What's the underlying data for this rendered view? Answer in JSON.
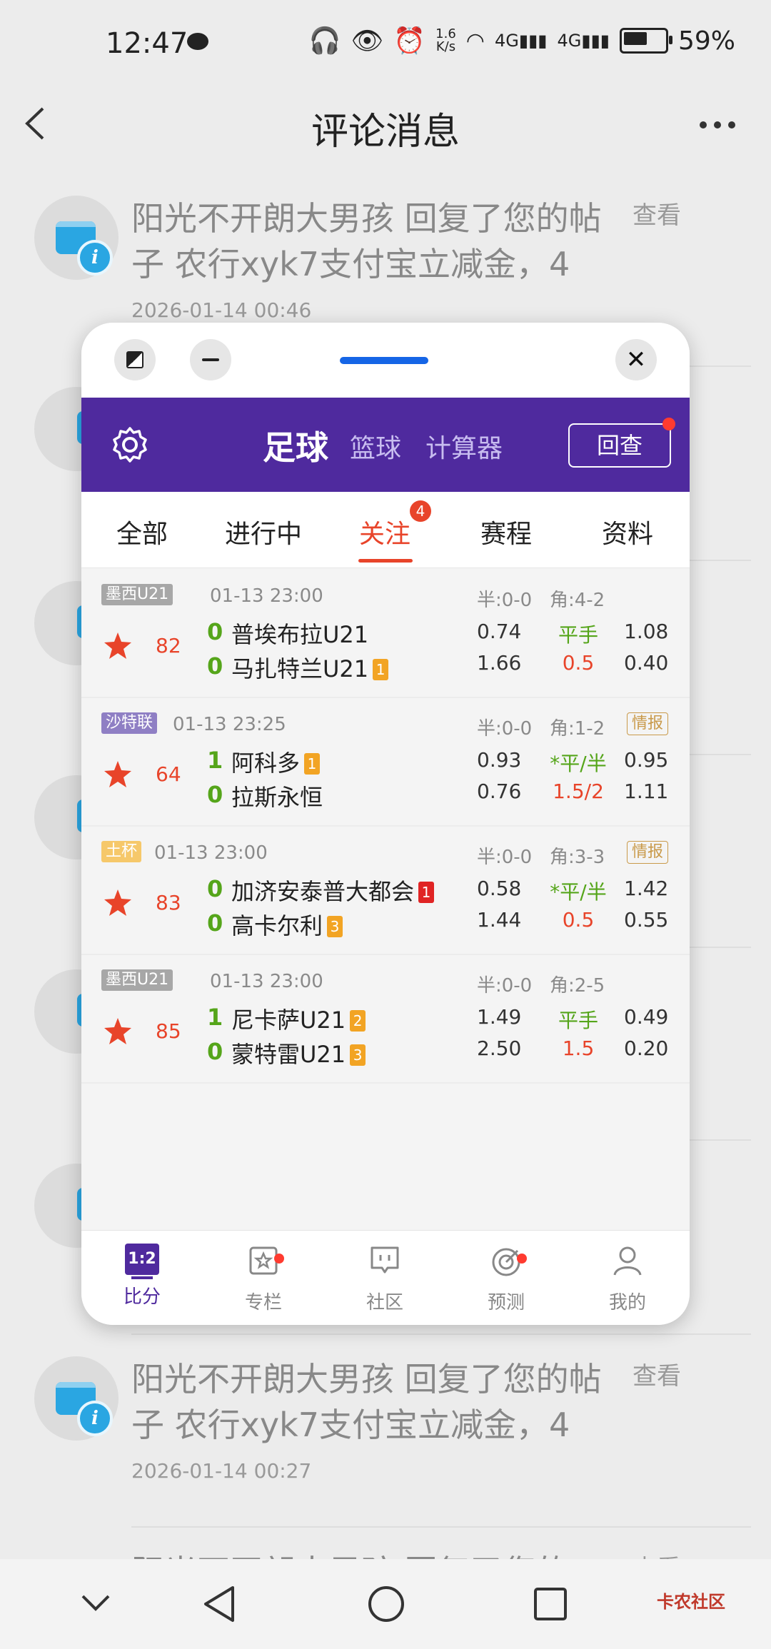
{
  "status_bar": {
    "time": "12:47",
    "net_speed": "1.6\nK/s",
    "signal1": "4G",
    "signal2": "4G",
    "battery": "59%"
  },
  "header": {
    "title": "评论消息"
  },
  "messages": [
    {
      "text": "阳光不开朗大男孩 回复了您的帖子 农行xyk7支付宝立减金，4",
      "time": "2026-01-14 00:46",
      "view": "查看"
    },
    {
      "text": "阳光不开朗大男孩 回复了您的帖子 农行xyk7支付宝立减金，4",
      "time": "2026-01-14 00:27",
      "view": "查看"
    },
    {
      "text": "阳光不开朗大男孩 回复了您的",
      "view": "查看"
    }
  ],
  "panel": {
    "nav": {
      "sports": [
        "足球",
        "篮球",
        "计算器"
      ],
      "recheck": "回查"
    },
    "tabs": [
      "全部",
      "进行中",
      "关注",
      "赛程",
      "资料"
    ],
    "follow_badge": "4",
    "matches": [
      {
        "league": "墨西U21",
        "league_color": "#a7a7a7",
        "time": "01-13 23:00",
        "half": "半:0-0",
        "corner": "角:4-2",
        "intel": "",
        "minute": "82",
        "home": {
          "score": "0",
          "name": "普埃布拉U21",
          "card": "",
          "card_type": ""
        },
        "away": {
          "score": "0",
          "name": "马扎特兰U21",
          "card": "1",
          "card_type": "y"
        },
        "odds": {
          "home": "0.74",
          "hcp": "平手",
          "hcp_color": "#55a51a",
          "away": "1.08",
          "home2": "1.66",
          "hcp2": "0.5",
          "away2": "0.40"
        }
      },
      {
        "league": "沙特联",
        "league_color": "#8f7fc4",
        "time": "01-13 23:25",
        "half": "半:0-0",
        "corner": "角:1-2",
        "intel": "情报",
        "minute": "64",
        "home": {
          "score": "1",
          "name": "阿科多",
          "card": "1",
          "card_type": "y"
        },
        "away": {
          "score": "0",
          "name": "拉斯永恒",
          "card": "",
          "card_type": ""
        },
        "odds": {
          "home": "0.93",
          "hcp": "*平/半",
          "hcp_color": "#55a51a",
          "away": "0.95",
          "home2": "0.76",
          "hcp2": "1.5/2",
          "away2": "1.11"
        }
      },
      {
        "league": "土杯",
        "league_color": "#f6c86a",
        "time": "01-13 23:00",
        "half": "半:0-0",
        "corner": "角:3-3",
        "intel": "情报",
        "minute": "83",
        "home": {
          "score": "0",
          "name": "加济安泰普大都会",
          "card": "1",
          "card_type": "r"
        },
        "away": {
          "score": "0",
          "name": "高卡尔利",
          "card": "3",
          "card_type": "y"
        },
        "odds": {
          "home": "0.58",
          "hcp": "*平/半",
          "hcp_color": "#55a51a",
          "away": "1.42",
          "home2": "1.44",
          "hcp2": "0.5",
          "away2": "0.55"
        }
      },
      {
        "league": "墨西U21",
        "league_color": "#a7a7a7",
        "time": "01-13 23:00",
        "half": "半:0-0",
        "corner": "角:2-5",
        "intel": "",
        "minute": "85",
        "home": {
          "score": "1",
          "name": "尼卡萨U21",
          "card": "2",
          "card_type": "y"
        },
        "away": {
          "score": "0",
          "name": "蒙特雷U21",
          "card": "3",
          "card_type": "y"
        },
        "odds": {
          "home": "1.49",
          "hcp": "平手",
          "hcp_color": "#55a51a",
          "away": "0.49",
          "home2": "2.50",
          "hcp2": "1.5",
          "away2": "0.20"
        }
      }
    ],
    "bottom_nav": [
      {
        "label": "比分",
        "icon": "score-icon",
        "badge": false
      },
      {
        "label": "专栏",
        "icon": "column-icon",
        "badge": true
      },
      {
        "label": "社区",
        "icon": "community-icon",
        "badge": false
      },
      {
        "label": "预测",
        "icon": "predict-icon",
        "badge": true
      },
      {
        "label": "我的",
        "icon": "profile-icon",
        "badge": false
      }
    ],
    "score_icon_text": "1:2"
  },
  "system_nav": {
    "watermark": "卡农社区"
  },
  "colors": {
    "brand_purple": "#4f2a9e",
    "accent_red": "#e8442a",
    "score_green": "#55a51a"
  }
}
